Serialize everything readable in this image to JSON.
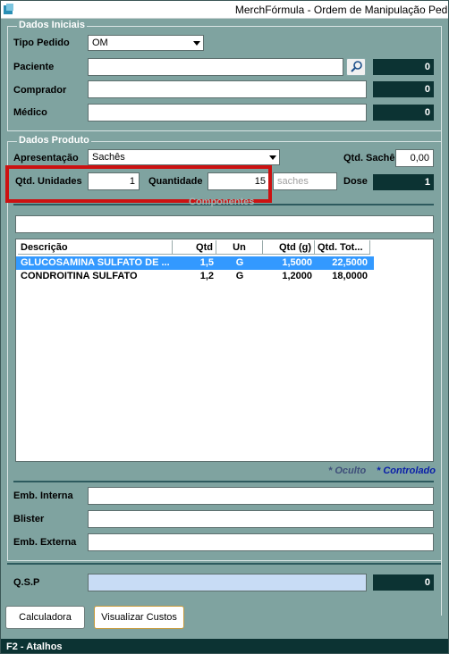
{
  "window": {
    "title": "MerchFórmula - Ordem de Manipulação Pedi"
  },
  "dados_iniciais": {
    "group_label": "Dados Iniciais",
    "tipo_pedido_label": "Tipo Pedido",
    "tipo_pedido_value": "OM",
    "paciente_label": "Paciente",
    "paciente_value": "",
    "paciente_count": "0",
    "comprador_label": "Comprador",
    "comprador_value": "",
    "comprador_count": "0",
    "medico_label": "Médico",
    "medico_value": "",
    "medico_count": "0"
  },
  "dados_produto": {
    "group_label": "Dados Produto",
    "apresentacao_label": "Apresentação",
    "apresentacao_value": "Sachês",
    "qtd_sache_label": "Qtd. Sachê",
    "qtd_sache_value": "0,00",
    "qtd_unidades_label": "Qtd. Unidades",
    "qtd_unidades_value": "1",
    "quantidade_label": "Quantidade",
    "quantidade_value": "15",
    "unidade_value": "saches",
    "dose_label": "Dose",
    "dose_value": "1",
    "componentes_label": "Componentes",
    "componentes_search_value": ""
  },
  "table": {
    "columns": [
      "Descrição",
      "Qtd",
      "Un",
      "Qtd (g)",
      "Qtd. Tot..."
    ],
    "rows": [
      {
        "descricao": "GLUCOSAMINA SULFATO DE ...",
        "qtd": "1,5",
        "un": "G",
        "qtd_g": "1,5000",
        "qtd_tot": "22,5000",
        "selected": true
      },
      {
        "descricao": "CONDROITINA SULFATO",
        "qtd": "1,2",
        "un": "G",
        "qtd_g": "1,2000",
        "qtd_tot": "18,0000",
        "selected": false
      }
    ]
  },
  "legend": {
    "oculto": "* Oculto",
    "controlado": "* Controlado"
  },
  "embalagens": {
    "emb_interna_label": "Emb. Interna",
    "emb_interna_value": "",
    "blister_label": "Blister",
    "blister_value": "",
    "emb_externa_label": "Emb. Externa",
    "emb_externa_value": ""
  },
  "qsp": {
    "label": "Q.S.P",
    "value": "",
    "count": "0"
  },
  "buttons": {
    "calculadora": "Calculadora",
    "visualizar_custos": "Visualizar Custos"
  },
  "status_bar": {
    "text": "F2 - Atalhos"
  },
  "colors": {
    "background": "#7fa3a0",
    "counter": "#0c3333",
    "selection": "#3399ff",
    "highlight": "#cc1111",
    "qsp_field": "#c8dcf5"
  },
  "icons": [
    "app-icon",
    "search-icon",
    "dropdown-arrow-icon"
  ]
}
